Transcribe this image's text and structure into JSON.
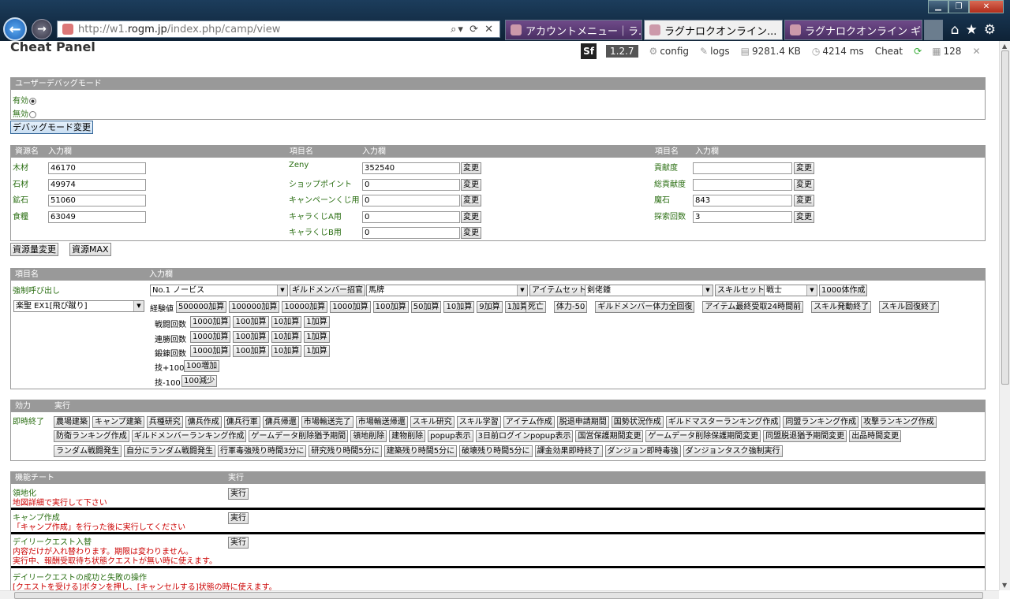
{
  "browser": {
    "url_prefix": "http://w1.",
    "url_domain": "rogm.jp",
    "url_path": "/index.php/camp/view",
    "tabs": [
      "アカウントメニュー｜ラ...",
      "ラグナロクオンライン...",
      "ラグナロクオンライン ギ..."
    ]
  },
  "title": "Cheat Panel",
  "sfbar": {
    "version": "1.2.7",
    "config": "config",
    "logs": "logs",
    "memory": "9281.4 KB",
    "time": "4214 ms",
    "cheat": "Cheat",
    "queries": "128"
  },
  "debug": {
    "header": "ユーザーデバッグモード",
    "enabled": "有効",
    "disabled": "無効",
    "button": "デバッグモード変更"
  },
  "resources": {
    "h1": "資源名",
    "h2": "入力欄",
    "h3": "項目名",
    "h4": "入力欄",
    "h5": "項目名",
    "h6": "入力欄",
    "col1": [
      {
        "label": "木材",
        "value": "46170"
      },
      {
        "label": "石材",
        "value": "49974"
      },
      {
        "label": "鉱石",
        "value": "51060"
      },
      {
        "label": "食糧",
        "value": "63049"
      }
    ],
    "col2": [
      {
        "label": "Zeny",
        "value": "352540"
      },
      {
        "label": "ショップポイント",
        "value": "0"
      },
      {
        "label": "キャンペーンくじ用",
        "value": "0"
      },
      {
        "label": "キャラくじA用",
        "value": "0"
      },
      {
        "label": "キャラくじB用",
        "value": "0"
      }
    ],
    "col3": [
      {
        "label": "貢献度",
        "value": ""
      },
      {
        "label": "総貢献度",
        "value": ""
      },
      {
        "label": "魔石",
        "value": "843"
      },
      {
        "label": "探索回数",
        "value": "3"
      }
    ],
    "change": "変更",
    "btn_change": "資源量変更",
    "btn_max": "資源MAX"
  },
  "items": {
    "h1": "項目名",
    "h2": "入力欄",
    "force_call": "強制呼び出し",
    "sel_novice": "No.1 ノービス",
    "btn_guild": "ギルドメンバー招官",
    "sel_horse": "馬牌",
    "btn_itemset": "アイテムセット",
    "sel_sword": "剣佬鍾",
    "btn_skillset": "スキルセット",
    "sel_warrior": "戦士",
    "btn_1000": "1000体作成",
    "sel_char": "楽聖 EX1[飛び蹴り]",
    "exp_label": "経験値",
    "exp_btns": [
      "500000加算",
      "100000加算",
      "10000加算",
      "1000加算",
      "100加算",
      "50加算",
      "10加算",
      "9加算",
      "1加算"
    ],
    "misc_btns": [
      "死亡",
      "体力-50",
      "ギルドメンバー体力全回復",
      "アイテム最終受取24時間前",
      "スキル発動終了",
      "スキル回復終了"
    ],
    "rows": [
      {
        "label": "戦闘回数",
        "btns": [
          "1000加算",
          "100加算",
          "10加算",
          "1加算"
        ]
      },
      {
        "label": "連勝回数",
        "btns": [
          "1000加算",
          "100加算",
          "10加算",
          "1加算"
        ]
      },
      {
        "label": "鍛錬回数",
        "btns": [
          "1000加算",
          "100加算",
          "10加算",
          "1加算"
        ]
      }
    ],
    "skill_plus": "技+100",
    "skill_plus_btn": "100増加",
    "skill_minus": "技-100",
    "skill_minus_btn": "100減少"
  },
  "effects": {
    "h1": "効力",
    "h2": "実行",
    "label": "即時終了",
    "row1": [
      "農場建築",
      "キャンプ建築",
      "兵種研究",
      "傭兵作成",
      "傭兵行軍",
      "傭兵帰還",
      "市場輸送完了",
      "市場輸送帰還",
      "スキル研究",
      "スキル学習",
      "アイテム作成",
      "脱退申請期間",
      "国勢状況作成",
      "ギルドマスターランキング作成",
      "同盟ランキング作成",
      "攻撃ランキング作成"
    ],
    "row2": [
      "防衛ランキング作成",
      "ギルドメンバーランキング作成",
      "ゲームデータ削除猶予期間",
      "領地削除",
      "建物削除",
      "popup表示",
      "3日前ログインpopup表示",
      "国営保護期間変更",
      "ゲームデータ削除保護期間変更",
      "同盟脱退猶予期間変更",
      "出品時間変更"
    ],
    "row3": [
      "ランダム戦闘発生",
      "自分にランダム戦闘発生",
      "行軍毒強残り時間3分に",
      "研究残り時間5分に",
      "建築残り時間5分に",
      "破壊残り時間5分に",
      "課金効果即時終了",
      "ダンジョン即時毒強",
      "ダンジョンタスク強制実行"
    ]
  },
  "functions": {
    "h1": "機能チート",
    "h2": "実行",
    "exec": "実行",
    "f1_title": "領地化",
    "f1_desc": "地図詳細で実行して下さい",
    "f2_title": "キャンプ作成",
    "f2_desc": "「キャンプ作成」を行った後に実行してください",
    "f3_title": "デイリークエスト入替",
    "f3_desc1": "内容だけが入れ替わります。期限は変わりません。",
    "f3_desc2": "実行中、報酬受取待ち状態クエストが無い時に使えます。",
    "f4_title": "デイリークエストの成功と失敗の操作",
    "f4_desc": "[クエストを受ける]ボタンを押し、[キャンセルする]状態の時に使えます。"
  }
}
